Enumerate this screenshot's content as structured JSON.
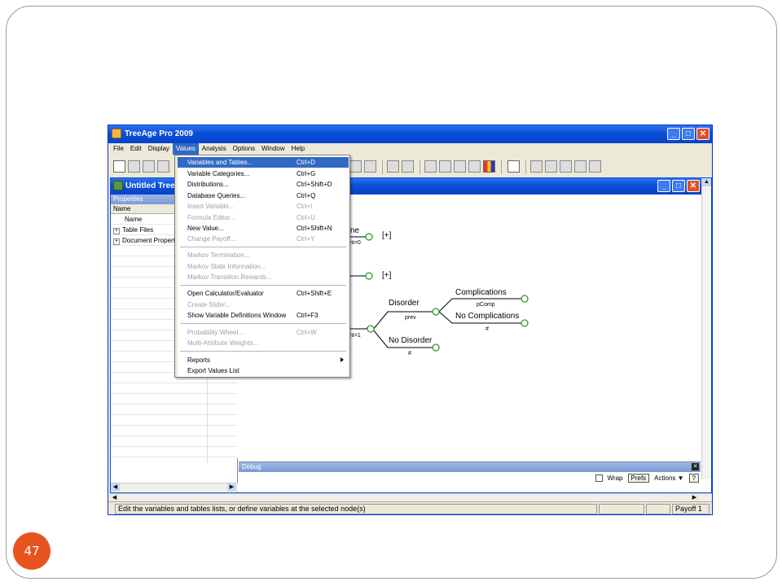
{
  "slide": {
    "page_number": "47"
  },
  "app": {
    "title": "TreeAge Pro 2009",
    "window_buttons": [
      "_",
      "□",
      "✕"
    ]
  },
  "menubar": {
    "items": [
      "File",
      "Edit",
      "Display",
      "Values",
      "Analysis",
      "Options",
      "Window",
      "Help"
    ],
    "active": "Values"
  },
  "document": {
    "title": "Untitled Tree"
  },
  "properties": {
    "header": "Properties",
    "column": "Name",
    "rows": [
      {
        "label": "Name",
        "expander": ""
      },
      {
        "label": "Table Files",
        "expander": "+"
      },
      {
        "label": "Document Properties",
        "expander": "+"
      }
    ]
  },
  "values_menu": {
    "items": [
      {
        "label": "Variables and Tables...",
        "shortcut": "Ctrl+D",
        "state": "highlighted"
      },
      {
        "label": "Variable Categories...",
        "shortcut": "Ctrl+G",
        "state": "enabled"
      },
      {
        "label": "Distributions...",
        "shortcut": "Ctrl+Shift+D",
        "state": "enabled"
      },
      {
        "label": "Database Queries...",
        "shortcut": "Ctrl+Q",
        "state": "enabled"
      },
      {
        "label": "Insert Variable...",
        "shortcut": "Ctrl+I",
        "state": "disabled"
      },
      {
        "label": "Formula Editor...",
        "shortcut": "Ctrl+U",
        "state": "disabled"
      },
      {
        "label": "New Value...",
        "shortcut": "Ctrl+Shift+N",
        "state": "enabled"
      },
      {
        "label": "Change Payoff...",
        "shortcut": "Ctrl+Y",
        "state": "disabled"
      },
      {
        "label": "Markov Termination...",
        "shortcut": "",
        "state": "disabled"
      },
      {
        "label": "Markov State Information...",
        "shortcut": "",
        "state": "disabled"
      },
      {
        "label": "Markov Transition Rewards...",
        "shortcut": "",
        "state": "disabled"
      },
      {
        "label": "Open Calculator/Evaluator",
        "shortcut": "Ctrl+Shift+E",
        "state": "enabled"
      },
      {
        "label": "Create Slider...",
        "shortcut": "",
        "state": "disabled"
      },
      {
        "label": "Show Variable Definitions Window",
        "shortcut": "Ctrl+F3",
        "state": "enabled"
      },
      {
        "label": "Probability Wheel...",
        "shortcut": "Ctrl+W",
        "state": "disabled"
      },
      {
        "label": "Multi-Attribute Weights...",
        "shortcut": "",
        "state": "disabled"
      },
      {
        "label": "Reports",
        "shortcut": "",
        "state": "submenu"
      },
      {
        "label": "Export Values List",
        "shortcut": "",
        "state": "enabled"
      }
    ]
  },
  "tree": {
    "branch1_label": "ne",
    "branch1_sub": "nt=0",
    "branch1_collapsed": "[+]",
    "branch2_collapsed": "[+]",
    "branch3_sub": "nt=1",
    "disorder": "Disorder",
    "disorder_prob": "prev",
    "no_disorder": "No Disorder",
    "no_disorder_prob": "#",
    "complications": "Complications",
    "complications_prob": "pComp",
    "no_complications": "No Complications",
    "no_complications_prob": "#"
  },
  "debug": {
    "header": "Debug",
    "wrap": "Wrap",
    "prefs": "Prefs",
    "actions": "Actions ▼",
    "help": "?"
  },
  "statusbar": {
    "message": "Edit the variables and tables lists, or define variables at the selected node(s)",
    "payoff": "Payoff 1"
  },
  "colors": {
    "titlebar": "#0a4fd9",
    "highlight": "#316ac5",
    "node_green": "#2f9a2f",
    "slide_badge": "#e8541f"
  }
}
